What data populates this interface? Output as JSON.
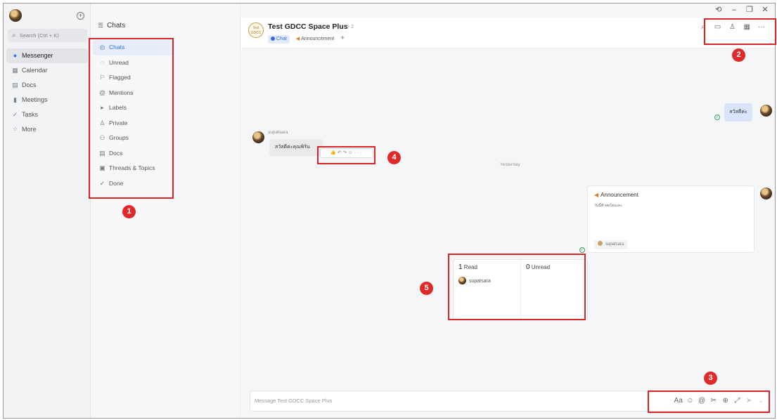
{
  "window": {
    "history_icon": "⟲",
    "minimize": "–",
    "restore": "❐",
    "close": "✕"
  },
  "nav": {
    "search_placeholder": "Search (Ctrl + K)",
    "items": [
      {
        "label": "Messenger",
        "icon": "messenger-icon"
      },
      {
        "label": "Calendar",
        "icon": "calendar-icon"
      },
      {
        "label": "Docs",
        "icon": "docs-icon"
      },
      {
        "label": "Meetings",
        "icon": "meetings-icon"
      },
      {
        "label": "Tasks",
        "icon": "tasks-icon"
      },
      {
        "label": "More",
        "icon": "more-icon"
      }
    ]
  },
  "chat_list": {
    "title": "Chats",
    "filters": [
      {
        "label": "Chats"
      },
      {
        "label": "Unread"
      },
      {
        "label": "Flagged"
      },
      {
        "label": "Mentions"
      },
      {
        "label": "Labels"
      },
      {
        "label": "Private"
      },
      {
        "label": "Groups"
      },
      {
        "label": "Docs"
      },
      {
        "label": "Threads & Topics"
      },
      {
        "label": "Done"
      }
    ]
  },
  "chat": {
    "avatar_text_1": "Test",
    "avatar_text_2": "GDCC",
    "title": "Test GDCC Space Plus",
    "member_count": "2",
    "tabs": [
      {
        "label": "Chat"
      },
      {
        "label": "Announcement"
      }
    ],
    "add_tab": "+"
  },
  "messages": {
    "outgoing_text": "สวัสดีค่ะ",
    "sender_name": "supatsara",
    "incoming_text": "สวัสดีค่ะคุณพิรัน",
    "reactions_more": "···",
    "date_separator": "Yesterday",
    "announcement": {
      "title": "Announcement",
      "body": "วันนี้ฟ้าสดใสนะคะ",
      "author": "supatsara"
    }
  },
  "read_receipt": {
    "read_count": "1",
    "read_label": "Read",
    "unread_count": "0",
    "unread_label": "Unread",
    "reader_name": "supatsara"
  },
  "composer": {
    "placeholder": "Message Test GDCC Space Plus",
    "format_label": "Aa"
  },
  "annotations": {
    "labels": [
      "1",
      "2",
      "3",
      "4",
      "5"
    ],
    "color": "#d9242a",
    "badge_color": "#e02a2a"
  },
  "colors": {
    "accent": "#2f6fe6",
    "outgoing_bubble": "#d8e5fb",
    "announcement_icon": "#e07a2f",
    "read_check": "#3aa36a"
  }
}
